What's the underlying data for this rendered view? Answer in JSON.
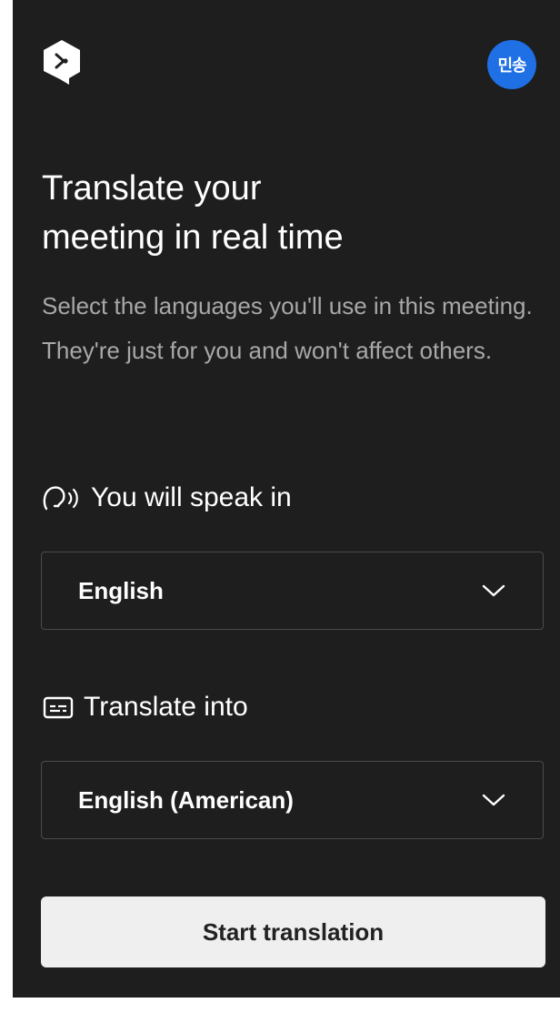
{
  "header": {
    "logo_icon": "deepl-logo-icon",
    "avatar_text": "민송",
    "avatar_color": "#1f6fe5"
  },
  "main": {
    "title_line1": "Translate your",
    "title_line2": "meeting in real time",
    "subtitle": "Select the languages you'll use in this meeting. They're just for you and won't affect others."
  },
  "speak": {
    "icon": "speaking-head-icon",
    "label": "You will speak in",
    "selected": "English"
  },
  "translate": {
    "icon": "subtitles-icon",
    "label": "Translate into",
    "selected": "English (American)"
  },
  "actions": {
    "start_label": "Start translation"
  },
  "colors": {
    "panel_background": "#1e1e1e",
    "button_background": "#efefef"
  }
}
